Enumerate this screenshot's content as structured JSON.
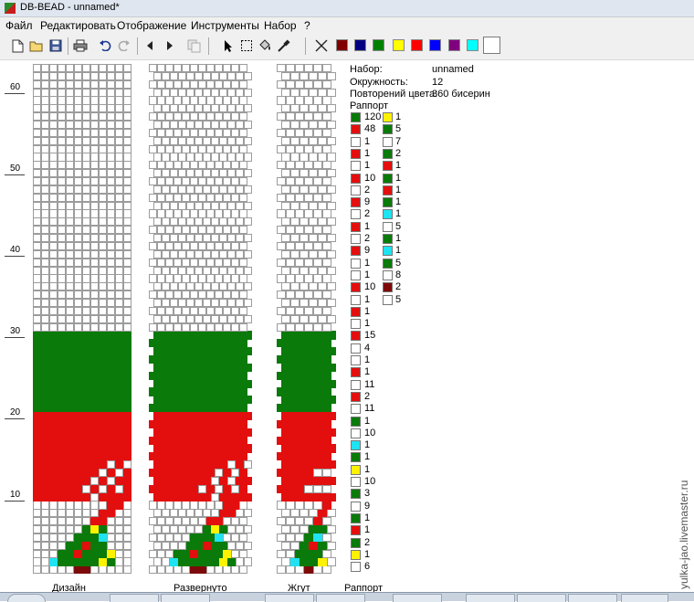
{
  "window": {
    "title": "DB-BEAD - unnamed*"
  },
  "menu": [
    {
      "id": "file",
      "label": "Файл"
    },
    {
      "id": "edit",
      "label": "Редактировать"
    },
    {
      "id": "view",
      "label": "Отображение"
    },
    {
      "id": "tools",
      "label": "Инструменты"
    },
    {
      "id": "set",
      "label": "Набор"
    },
    {
      "id": "help",
      "label": "?"
    }
  ],
  "toolbar": {
    "icons": [
      "new-file-icon",
      "open-folder-icon",
      "save-icon",
      "print-icon",
      "undo-icon",
      "redo-icon",
      "arrow-left-icon",
      "arrow-right-icon",
      "copy-icon",
      "select-pointer-icon",
      "select-rectangle-icon",
      "fill-bucket-icon",
      "eyedropper-icon",
      "delete-cross-icon"
    ],
    "palette": [
      "#800000",
      "#000080",
      "#008000",
      "#ffff00",
      "#ff0000",
      "#0000ff",
      "#800080",
      "#00ffff",
      "#ffffff"
    ]
  },
  "ruler": {
    "labels": [
      "60",
      "50",
      "40",
      "30",
      "20",
      "10"
    ]
  },
  "panels": {
    "design_label": "Дизайн",
    "unrolled_label": "Развернуто",
    "rope_label": "Жгут",
    "rapport_label": "Раппорт"
  },
  "colors": {
    "white": "#ffffff",
    "green": "#0a7a0a",
    "red": "#e30f0f",
    "cyan": "#1fe3f2",
    "yellow": "#fff200",
    "darkred": "#7d0a0a",
    "grid": "#9c9c9c"
  },
  "info": {
    "set_label": "Набор:",
    "set_value": "unnamed",
    "circ_label": "Окружность:",
    "circ_value": "12",
    "repeat_label": "Повторений цвета:",
    "repeat_value": "360 бисерин",
    "rapport_label": "Раппорт"
  },
  "rapport_col1": [
    {
      "c": "green",
      "n": "120"
    },
    {
      "c": "red",
      "n": "48"
    },
    {
      "c": "white",
      "n": "1"
    },
    {
      "c": "red",
      "n": "1"
    },
    {
      "c": "white",
      "n": "1"
    },
    {
      "c": "red",
      "n": "10"
    },
    {
      "c": "white",
      "n": "2"
    },
    {
      "c": "red",
      "n": "9"
    },
    {
      "c": "white",
      "n": "2"
    },
    {
      "c": "red",
      "n": "1"
    },
    {
      "c": "white",
      "n": "2"
    },
    {
      "c": "red",
      "n": "9"
    },
    {
      "c": "white",
      "n": "1"
    },
    {
      "c": "white",
      "n": "1"
    },
    {
      "c": "red",
      "n": "10"
    },
    {
      "c": "white",
      "n": "1"
    },
    {
      "c": "red",
      "n": "1"
    },
    {
      "c": "white",
      "n": "1"
    },
    {
      "c": "red",
      "n": "15"
    },
    {
      "c": "white",
      "n": "4"
    },
    {
      "c": "white",
      "n": "1"
    },
    {
      "c": "red",
      "n": "1"
    },
    {
      "c": "white",
      "n": "11"
    },
    {
      "c": "red",
      "n": "2"
    },
    {
      "c": "white",
      "n": "11"
    },
    {
      "c": "green",
      "n": "1"
    },
    {
      "c": "white",
      "n": "10"
    },
    {
      "c": "cyan",
      "n": "1"
    },
    {
      "c": "green",
      "n": "1"
    },
    {
      "c": "yellow",
      "n": "1"
    },
    {
      "c": "white",
      "n": "10"
    },
    {
      "c": "green",
      "n": "3"
    },
    {
      "c": "white",
      "n": "9"
    },
    {
      "c": "green",
      "n": "1"
    },
    {
      "c": "red",
      "n": "1"
    },
    {
      "c": "green",
      "n": "2"
    },
    {
      "c": "yellow",
      "n": "1"
    },
    {
      "c": "white",
      "n": "6"
    }
  ],
  "rapport_col2": [
    {
      "c": "yellow",
      "n": "1"
    },
    {
      "c": "green",
      "n": "5"
    },
    {
      "c": "white",
      "n": "7"
    },
    {
      "c": "green",
      "n": "2"
    },
    {
      "c": "red",
      "n": "1"
    },
    {
      "c": "green",
      "n": "1"
    },
    {
      "c": "red",
      "n": "1"
    },
    {
      "c": "green",
      "n": "1"
    },
    {
      "c": "cyan",
      "n": "1"
    },
    {
      "c": "white",
      "n": "5"
    },
    {
      "c": "green",
      "n": "1"
    },
    {
      "c": "cyan",
      "n": "1"
    },
    {
      "c": "green",
      "n": "5"
    },
    {
      "c": "white",
      "n": "8"
    },
    {
      "c": "darkred",
      "n": "2"
    },
    {
      "c": "white",
      "n": "5"
    }
  ],
  "watermark": "yulka-jao.livemaster.ru"
}
